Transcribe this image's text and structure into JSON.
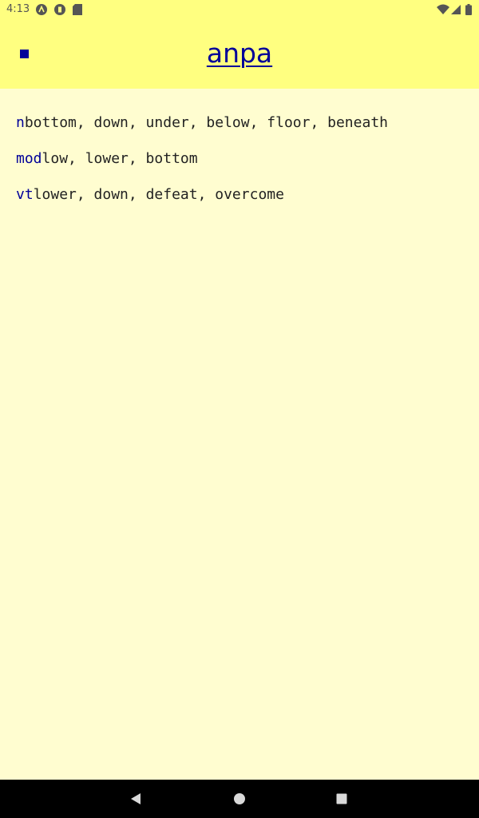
{
  "status_bar": {
    "time": "4:13",
    "left_icons": [
      "android-debug-icon",
      "app-notification-icon",
      "sd-card-icon"
    ],
    "right_icons": [
      "wifi-icon",
      "signal-icon",
      "battery-icon"
    ]
  },
  "app_bar": {
    "title": "anpa",
    "menu_icon": "menu-square-icon"
  },
  "entries": [
    {
      "pos": "n",
      "gloss": "bottom, down, under, below, floor, beneath"
    },
    {
      "pos": "mod",
      "gloss": "low, lower, bottom"
    },
    {
      "pos": "vt",
      "gloss": "lower, down, defeat, overcome"
    }
  ],
  "nav_bar": {
    "buttons": [
      "back-icon",
      "home-icon",
      "recents-icon"
    ]
  },
  "colors": {
    "app_bar_bg": "#ffff80",
    "page_bg": "#fffdd0",
    "accent": "#000099",
    "text": "#222222"
  }
}
